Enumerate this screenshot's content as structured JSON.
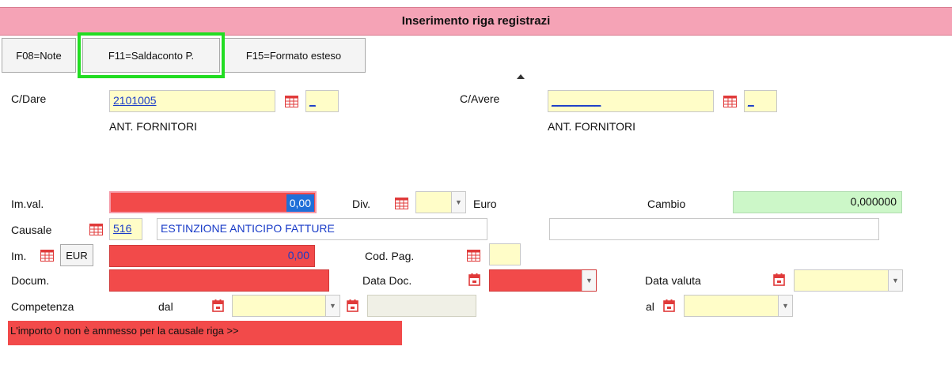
{
  "window": {
    "title": "Inserimento riga registrazi"
  },
  "toolbar": {
    "f08_label": "F08=Note",
    "f11_label": "F11=Saldaconto P.",
    "f15_label": "F15=Formato esteso"
  },
  "dare": {
    "label": "C/Dare",
    "value": "2101005",
    "small": "_",
    "desc": "ANT. FORNITORI"
  },
  "avere": {
    "label": "C/Avere",
    "value": "________",
    "small": "_",
    "desc": "ANT. FORNITORI"
  },
  "imval": {
    "label": "Im.val.",
    "value": "0,00"
  },
  "div": {
    "label": "Div.",
    "currency": "Euro"
  },
  "cambio": {
    "label": "Cambio",
    "value": "0,000000"
  },
  "causale": {
    "label": "Causale",
    "code": "516",
    "desc": "ESTINZIONE ANTICIPO FATTURE"
  },
  "im": {
    "label": "Im.",
    "currency": "EUR",
    "value": "0,00"
  },
  "codpag": {
    "label": "Cod. Pag."
  },
  "docum": {
    "label": "Docum."
  },
  "datadoc": {
    "label": "Data Doc."
  },
  "datavaluta": {
    "label": "Data valuta"
  },
  "competenza": {
    "label": "Competenza",
    "dal_label": "dal",
    "al_label": "al"
  },
  "error": {
    "message": "L'importo 0 non è ammesso per la causale riga >>"
  },
  "colors": {
    "title_bg": "#f5a3b6",
    "required": "#f24a4a",
    "input": "#fffdc8",
    "highlight": "#22dd22",
    "link": "#1a3cc8"
  }
}
